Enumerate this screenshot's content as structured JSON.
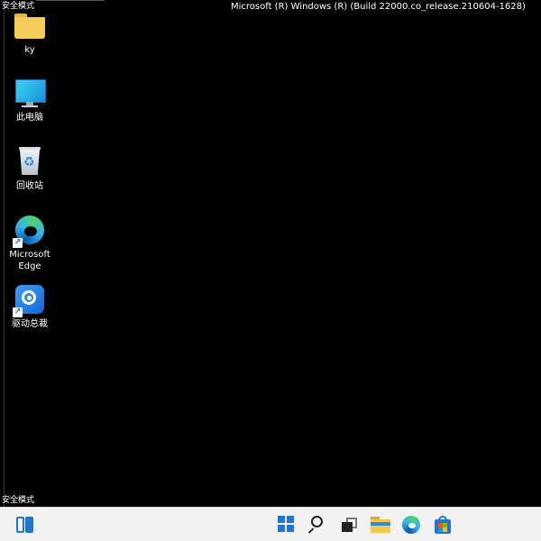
{
  "overlay": {
    "safe_mode_top": "安全模式",
    "safe_mode_bottom": "安全模式",
    "build_info": "Microsoft (R) Windows (R) (Build 22000.co_release.210604-1628)"
  },
  "desktop": {
    "icons": [
      {
        "label": "ky",
        "icon": "folder-icon"
      },
      {
        "label": "此电脑",
        "icon": "this-pc-icon"
      },
      {
        "label": "回收站",
        "icon": "recycle-bin-icon"
      },
      {
        "label": "Microsoft Edge",
        "icon": "edge-icon",
        "shortcut": true
      },
      {
        "label": "驱动总裁",
        "icon": "driver-tool-icon",
        "shortcut": true
      }
    ]
  },
  "taskbar": {
    "items": [
      "widgets-icon",
      "start-icon",
      "search-icon",
      "task-view-icon",
      "file-explorer-icon",
      "edge-icon",
      "store-icon"
    ],
    "accent": "#1f77d2"
  },
  "colors": {
    "background": "#000000",
    "taskbar": "#f2f2f2"
  }
}
